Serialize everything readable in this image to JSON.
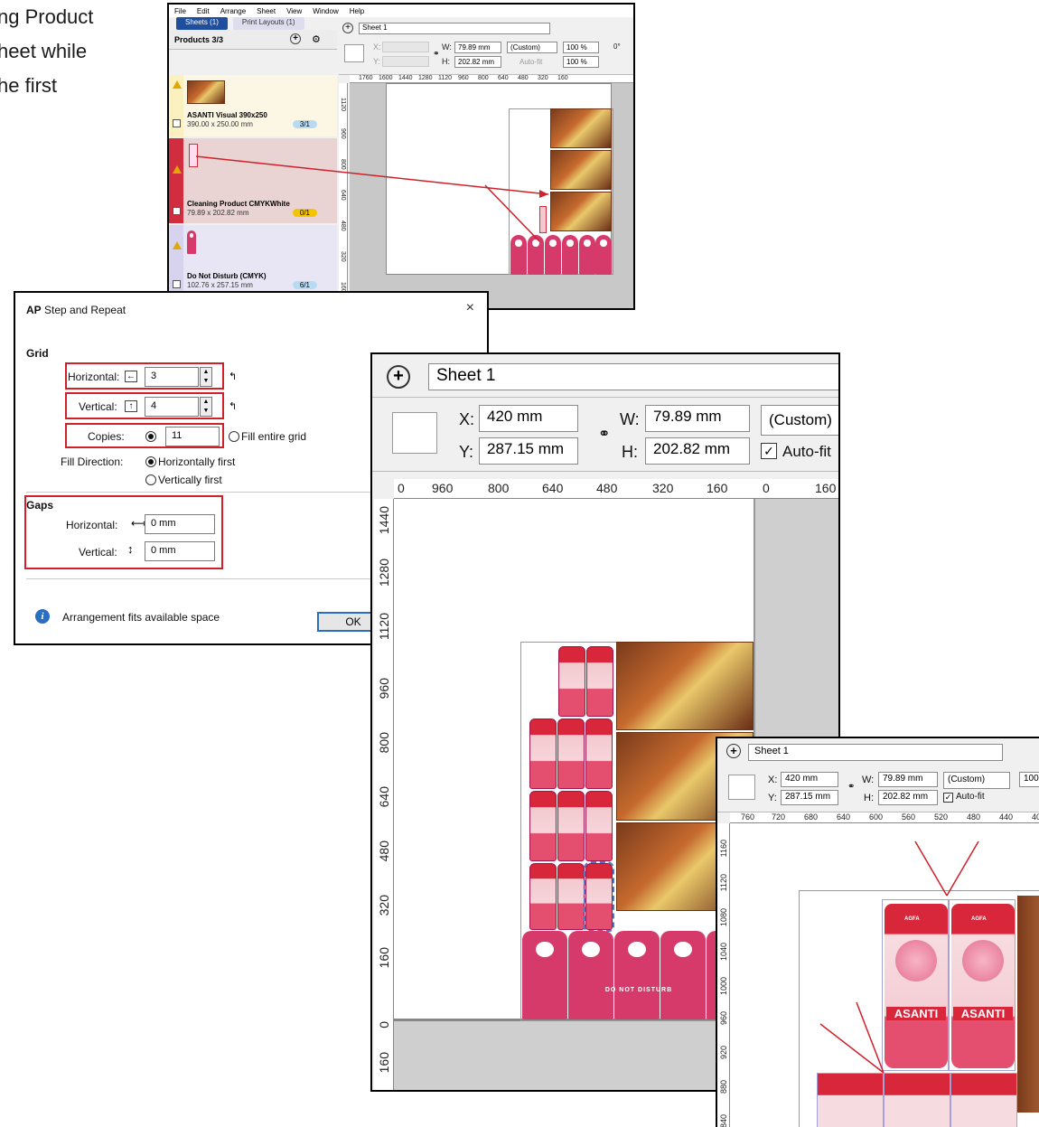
{
  "intro": {
    "line1": "ng Product",
    "line2": "heet while",
    "line3": "he first"
  },
  "small_window": {
    "menu": [
      "File",
      "Edit",
      "Arrange",
      "Sheet",
      "View",
      "Window",
      "Help"
    ],
    "tabs": [
      "Sheets (1)",
      "Print Layouts (1)"
    ],
    "panel_title": "Products 3/3",
    "sheet_select": "Sheet 1",
    "fields": {
      "x_label": "X:",
      "y_label": "Y:",
      "w_label": "W:",
      "h_label": "H:",
      "w": "79.89 mm",
      "h": "202.82 mm",
      "preset": "(Custom)",
      "autofit": "Auto-fit",
      "scale1": "100 %",
      "scale2": "100 %",
      "rot": "0°"
    },
    "ruler_top": [
      "1760",
      "1600",
      "1440",
      "1280",
      "1120",
      "960",
      "800",
      "640",
      "480",
      "320",
      "160"
    ],
    "ruler_left": [
      "1120",
      "960",
      "800",
      "640",
      "480",
      "320",
      "160"
    ],
    "products": [
      {
        "name": "ASANTI Visual 390x250",
        "dims": "390.00 x 250.00 mm",
        "count": "3/1",
        "badge_color": "#b9dbf2"
      },
      {
        "name": "Cleaning Product CMYKWhite",
        "dims": "79.89 x 202.82 mm",
        "count": "0/1",
        "badge_color": "#f4c400"
      },
      {
        "name": "Do Not Disturb (CMYK)",
        "dims": "102.76 x 257.15 mm",
        "count": "6/1",
        "badge_color": "#b9dbf2"
      }
    ]
  },
  "dialog": {
    "title": "Step and Repeat",
    "app_icon": "AP",
    "grid_label": "Grid",
    "horizontal_label": "Horizontal:",
    "horizontal_value": "3",
    "vertical_label": "Vertical:",
    "vertical_value": "4",
    "copies_label": "Copies:",
    "copies_value": "11",
    "fill_grid": "Fill entire grid",
    "fill_direction_label": "Fill Direction:",
    "horiz_first": "Horizontally first",
    "vert_first": "Vertically first",
    "gaps_label": "Gaps",
    "gap_h_label": "Horizontal:",
    "gap_h_value": "0 mm",
    "gap_v_label": "Vertical:",
    "gap_v_value": "0 mm",
    "status": "Arrangement fits available space",
    "ok": "OK"
  },
  "big_window": {
    "sheet_select": "Sheet 1",
    "x_label": "X:",
    "x": "420 mm",
    "y_label": "Y:",
    "y": "287.15 mm",
    "w_label": "W:",
    "w": "79.89 mm",
    "h_label": "H:",
    "h": "202.82 mm",
    "preset": "(Custom)",
    "autofit": "Auto-fit",
    "ruler_top": [
      "0",
      "960",
      "800",
      "640",
      "480",
      "320",
      "160",
      "0",
      "160"
    ],
    "ruler_left": [
      "1440",
      "1280",
      "1120",
      "960",
      "800",
      "640",
      "480",
      "320",
      "160",
      "0",
      "160"
    ],
    "door_hanger_text": "DO NOT DISTURB"
  },
  "zoom_window": {
    "sheet_select": "Sheet 1",
    "x_label": "X:",
    "x": "420 mm",
    "y_label": "Y:",
    "y": "287.15 mm",
    "w_label": "W:",
    "w": "79.89 mm",
    "h_label": "H:",
    "h": "202.82 mm",
    "preset": "(Custom)",
    "autofit": "Auto-fit",
    "scale": "100",
    "ruler_top": [
      "760",
      "720",
      "680",
      "640",
      "600",
      "560",
      "520",
      "480",
      "440",
      "40"
    ],
    "ruler_left": [
      "1160",
      "1120",
      "1080",
      "1040",
      "1000",
      "960",
      "920",
      "880",
      "840"
    ],
    "brand": "ASANTI",
    "maker": "AGFA"
  },
  "colors": {
    "accent": "#1f4e9c",
    "highlight": "#d0202a",
    "product_pink": "#d63a6a"
  }
}
